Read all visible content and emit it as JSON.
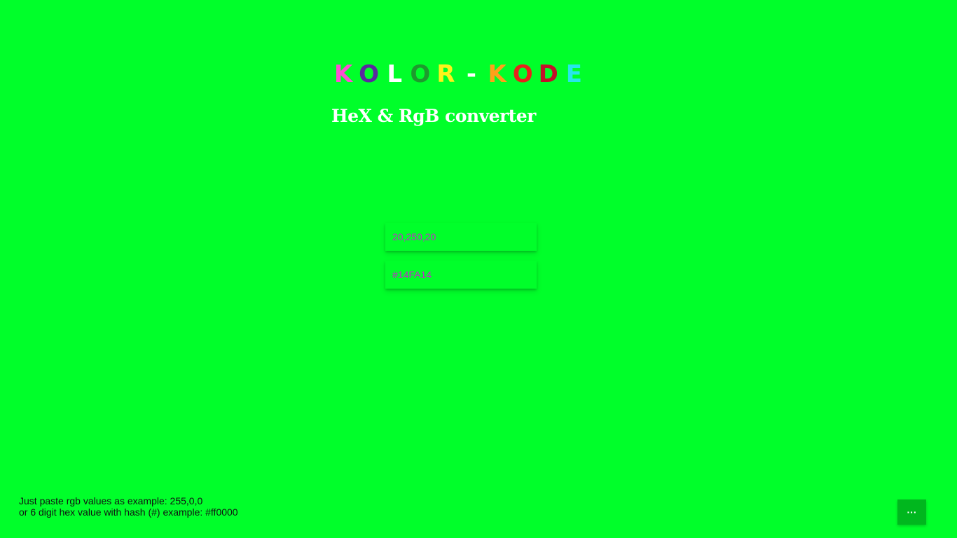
{
  "app": {
    "title_letters": [
      {
        "char": "K",
        "color": "#ff4ed3"
      },
      {
        "char": "O",
        "color": "#5a2a9e"
      },
      {
        "char": "L",
        "color": "#ffffff"
      },
      {
        "char": "O",
        "color": "#1e9a2e"
      },
      {
        "char": "R",
        "color": "#fff21a"
      },
      {
        "char": "-",
        "color": "#ffffff"
      },
      {
        "char": "K",
        "color": "#ffa019"
      },
      {
        "char": "O",
        "color": "#e8221c"
      },
      {
        "char": "D",
        "color": "#c4102a"
      },
      {
        "char": "E",
        "color": "#27e6ec"
      }
    ],
    "subtitle": "HeX & RgB converter"
  },
  "converter": {
    "rgb_value": "20,250,20",
    "hex_value": "#14FA14"
  },
  "help": {
    "line1": "Just paste rgb values as example: 255,0,0",
    "line2": "or 6 digit hex value with hash (#) example: #ff0000"
  },
  "menu": {
    "more_label": "···"
  },
  "colors": {
    "background": "#00ff2a",
    "input_text": "#c02cc8",
    "button": "#00b71e"
  }
}
